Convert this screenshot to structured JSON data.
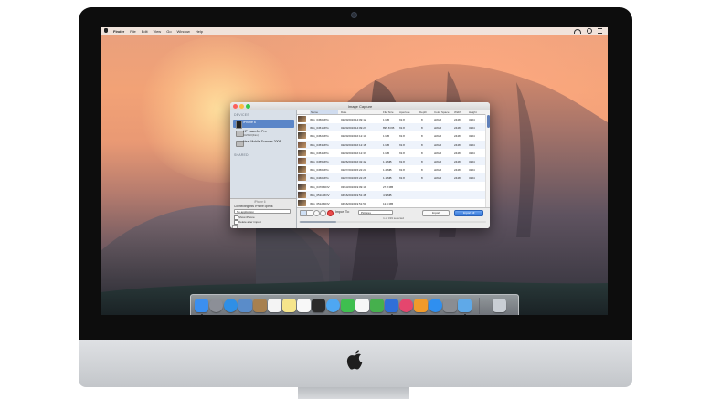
{
  "menubar": {
    "app": "Finder",
    "items": [
      "File",
      "Edit",
      "View",
      "Go",
      "Window",
      "Help"
    ]
  },
  "window": {
    "title": "Image Capture",
    "sidebar": {
      "devices_header": "DEVICES",
      "shared_header": "SHARED",
      "devices": [
        {
          "name": "iPhone 6",
          "sub": "",
          "selected": true
        },
        {
          "name": "HP LaserJet Pro",
          "sub": "CH5H0(Fax)",
          "selected": false
        },
        {
          "name": "Neat Mobile Scanner 2008",
          "sub": "",
          "selected": false
        }
      ],
      "device_footer": "iPhone 6",
      "connecting_label": "Connecting this iPhone opens:",
      "connecting_value": "No application",
      "checkbox_delete": "Delete after import",
      "checkbox_show": "Show iPhone"
    },
    "table": {
      "columns": [
        "Name",
        "Date",
        "File Size",
        "Aperture",
        "Depth",
        "Color Space",
        "Width",
        "Height"
      ],
      "rows": [
        {
          "name": "IMG_0450.JPG",
          "date": "02/20/2016 14:09:12",
          "size": "1 MB",
          "aperture": "f/2.8",
          "depth": "8",
          "space": "sRGB",
          "width": "2448",
          "height": "3264"
        },
        {
          "name": "IMG_0451.JPG",
          "date": "02/20/2016 14:09:27",
          "size": "895.8 KB",
          "aperture": "f/2.8",
          "depth": "8",
          "space": "sRGB",
          "width": "2448",
          "height": "3264"
        },
        {
          "name": "IMG_0452.JPG",
          "date": "02/20/2016 16:12:10",
          "size": "1 MB",
          "aperture": "f/2.8",
          "depth": "8",
          "space": "sRGB",
          "width": "2448",
          "height": "3264"
        },
        {
          "name": "IMG_0453.JPG",
          "date": "02/20/2016 16:12:18",
          "size": "1 MB",
          "aperture": "f/2.8",
          "depth": "8",
          "space": "sRGB",
          "width": "2448",
          "height": "3264"
        },
        {
          "name": "IMG_0454.JPG",
          "date": "02/20/2016 16:12:37",
          "size": "1 MB",
          "aperture": "f/2.8",
          "depth": "8",
          "space": "sRGB",
          "width": "2448",
          "height": "3264"
        },
        {
          "name": "IMG_0455.JPG",
          "date": "02/26/2016 16:32:42",
          "size": "1.1 MB",
          "aperture": "f/2.8",
          "depth": "8",
          "space": "sRGB",
          "width": "2448",
          "height": "3264"
        },
        {
          "name": "IMG_0456.JPG",
          "date": "02/27/2016 15:22:23",
          "size": "1.2 MB",
          "aperture": "f/2.8",
          "depth": "8",
          "space": "sRGB",
          "width": "2448",
          "height": "3264"
        },
        {
          "name": "IMG_0460.JPG",
          "date": "02/27/2016 15:22:26",
          "size": "1.1 MB",
          "aperture": "f/2.8",
          "depth": "8",
          "space": "sRGB",
          "width": "2448",
          "height": "3264"
        },
        {
          "name": "IMG_0470.MOV",
          "date": "03/13/2016 19:09:19",
          "size": "27.8 MB",
          "aperture": "",
          "depth": "",
          "space": "",
          "width": "",
          "height": ""
        },
        {
          "name": "IMG_0511.MOV",
          "date": "04/16/2016 19:51:48",
          "size": "4.9 MB",
          "aperture": "",
          "depth": "",
          "space": "",
          "width": "",
          "height": ""
        },
        {
          "name": "IMG_0512.MOV",
          "date": "04/16/2016 19:51:50",
          "size": "12.5 MB",
          "aperture": "",
          "depth": "",
          "space": "",
          "width": "",
          "height": ""
        }
      ]
    },
    "bottombar": {
      "import_to_label": "Import To:",
      "import_to_value": "Pictures",
      "import_button": "Import",
      "import_all_button": "Import All",
      "selection_count": "1 of 319 selected"
    }
  },
  "dock": {
    "apps": [
      {
        "name": "Finder",
        "color": "#3b8ff0",
        "round": false
      },
      {
        "name": "Launchpad",
        "color": "#8c8f97",
        "round": true
      },
      {
        "name": "Safari",
        "color": "#2f8fe6",
        "round": true
      },
      {
        "name": "Preview",
        "color": "#5a8cc9",
        "round": false
      },
      {
        "name": "Contacts",
        "color": "#a7804f",
        "round": false
      },
      {
        "name": "Calendar",
        "color": "#f4f4f4",
        "round": false
      },
      {
        "name": "Notes",
        "color": "#f6e58b",
        "round": false
      },
      {
        "name": "Reminders",
        "color": "#f8f8f8",
        "round": false
      },
      {
        "name": "Photo Booth",
        "color": "#2b2b2b",
        "round": false
      },
      {
        "name": "Messages",
        "color": "#4ea7f2",
        "round": true
      },
      {
        "name": "FaceTime",
        "color": "#3fbf4f",
        "round": false
      },
      {
        "name": "Photos",
        "color": "#f7f7f7",
        "round": false
      },
      {
        "name": "Numbers",
        "color": "#46b04d",
        "round": false
      },
      {
        "name": "Keynote",
        "color": "#2f6fd8",
        "round": false
      },
      {
        "name": "iTunes",
        "color": "#e5466e",
        "round": true
      },
      {
        "name": "iBooks",
        "color": "#f09a2a",
        "round": false
      },
      {
        "name": "App Store",
        "color": "#2f8ff0",
        "round": true
      },
      {
        "name": "System Preferences",
        "color": "#8a8d93",
        "round": false
      },
      {
        "name": "Downloads",
        "color": "#5fa9e8",
        "round": false
      },
      {
        "name": "Trash",
        "color": "#c9ced4",
        "round": false
      }
    ]
  }
}
